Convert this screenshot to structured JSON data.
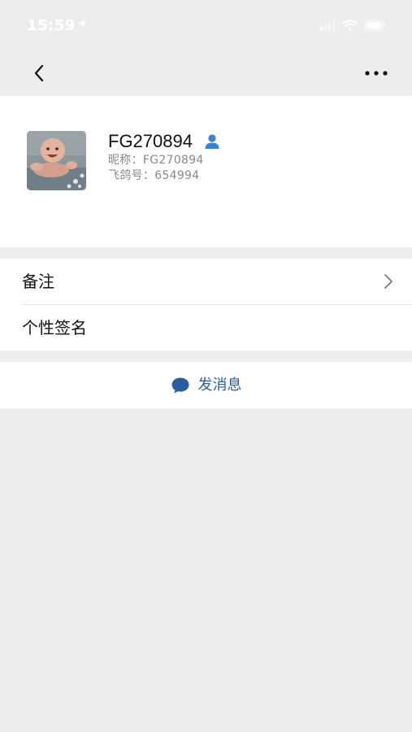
{
  "status_bar": {
    "time": "15:59"
  },
  "profile": {
    "name": "FG270894",
    "nickname_line": "昵称：FG270894",
    "id_line": "飞鸽号：654994"
  },
  "list": {
    "remark_label": "备注",
    "signature_label": "个性签名"
  },
  "actions": {
    "send_message_label": "发消息"
  },
  "colors": {
    "background": "#ededed",
    "card": "#ffffff",
    "accent": "#2a5d9f",
    "person_icon": "#3b7fd8"
  },
  "icons": {
    "back": "chevron-left-icon",
    "more": "more-dots-icon",
    "person": "person-icon",
    "chevron": "chevron-right-icon",
    "chat": "chat-bubble-icon"
  }
}
